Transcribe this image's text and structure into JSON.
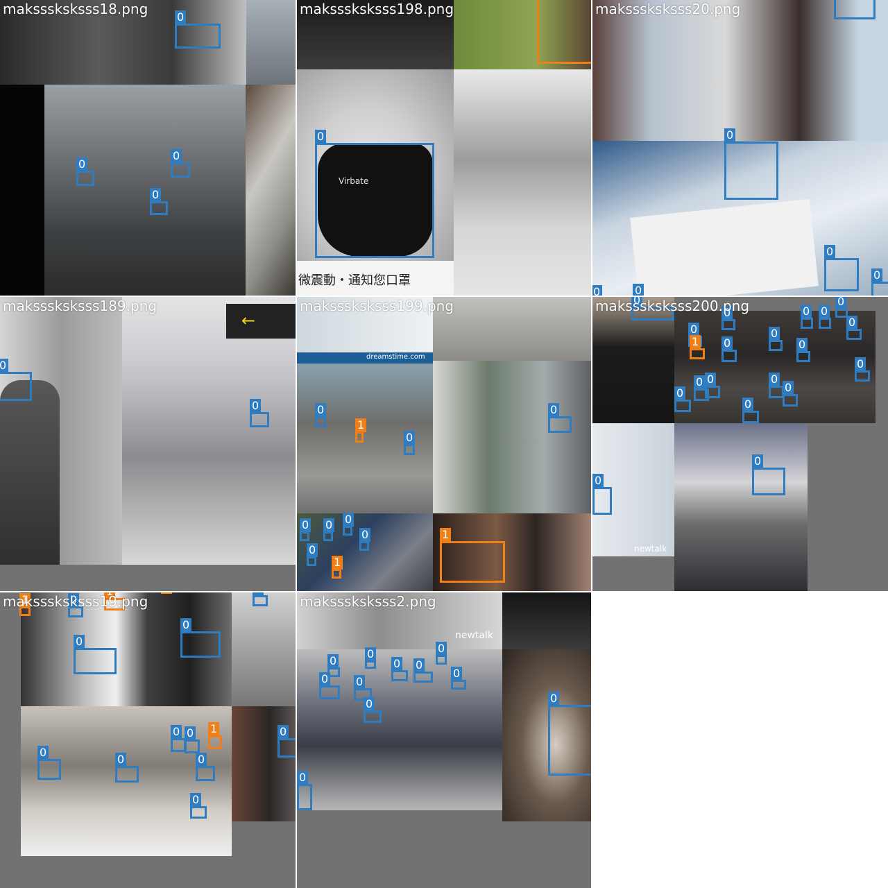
{
  "colors": {
    "class_0": "#2f7cc0",
    "class_1": "#f07f17",
    "background": "#727272"
  },
  "tiles": [
    {
      "title": "maksssksksss18.png"
    },
    {
      "title": "maksssksksss198.png",
      "photo_texts": [
        "Virbate",
        "微震動・通知您口罩"
      ]
    },
    {
      "title": "maksssksksss20.png"
    },
    {
      "title": "maksssksksss189.png"
    },
    {
      "title": "maksssksksss199.png",
      "photo_texts": [
        "dreamstime.com"
      ]
    },
    {
      "title": "maksssksksss200.png",
      "photo_texts": [
        "newtalk"
      ]
    },
    {
      "title": "maksssksksss19.png"
    },
    {
      "title": "maksssksksss2.png",
      "photo_texts": [
        "newtalk"
      ]
    }
  ],
  "class_labels": {
    "zero": "0",
    "one": "1"
  }
}
